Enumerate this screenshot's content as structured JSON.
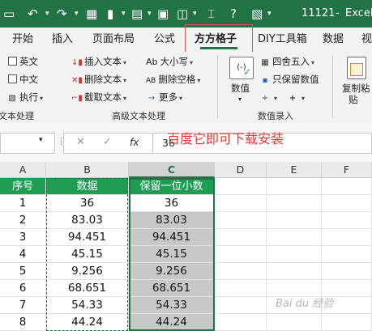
{
  "titlebar": {
    "undo_icon": "undo-icon",
    "file_name": "11121",
    "app_name": "Excel"
  },
  "tabs": [
    {
      "label": "开始"
    },
    {
      "label": "插入"
    },
    {
      "label": "页面布局"
    },
    {
      "label": "公式"
    },
    {
      "label": "方方格子"
    },
    {
      "label": "DIY工具箱"
    },
    {
      "label": "数据"
    },
    {
      "label": "视"
    }
  ],
  "ribbon": {
    "col1": [
      "英文",
      "中文",
      "执行"
    ],
    "col2": [
      "插入文本",
      "删除文本",
      "截取文本"
    ],
    "col3": [
      "大小写",
      "删除空格",
      "更多"
    ],
    "col3_prefix": [
      "Ab",
      "AB"
    ],
    "numeric_label": "数值",
    "numeric_icon_text": "(-)",
    "col5": [
      "四舍五入",
      "只保留数值"
    ],
    "col5_ops": [
      "÷",
      "+"
    ],
    "paste_label_1": "复制粘",
    "paste_label_2": "贴",
    "groups": [
      "文本处理",
      "高级文本处理",
      "数值录入"
    ]
  },
  "formula_bar": {
    "fx": "fx",
    "value": "36"
  },
  "annotation": "百度它即可下载安装",
  "grid": {
    "columns": [
      "A",
      "B",
      "C",
      "D",
      "E",
      "F"
    ],
    "header_row": [
      "序号",
      "数据",
      "保留一位小数"
    ],
    "rows": [
      [
        "1",
        "36",
        "36"
      ],
      [
        "2",
        "83.03",
        "83.03"
      ],
      [
        "3",
        "94.451",
        "94.451"
      ],
      [
        "4",
        "45.15",
        "45.15"
      ],
      [
        "5",
        "9.256",
        "9.256"
      ],
      [
        "6",
        "68.651",
        "68.651"
      ],
      [
        "7",
        "54.33",
        "54.33"
      ],
      [
        "8",
        "44.24",
        "44.24"
      ]
    ]
  },
  "watermark": "Bai du 经验"
}
